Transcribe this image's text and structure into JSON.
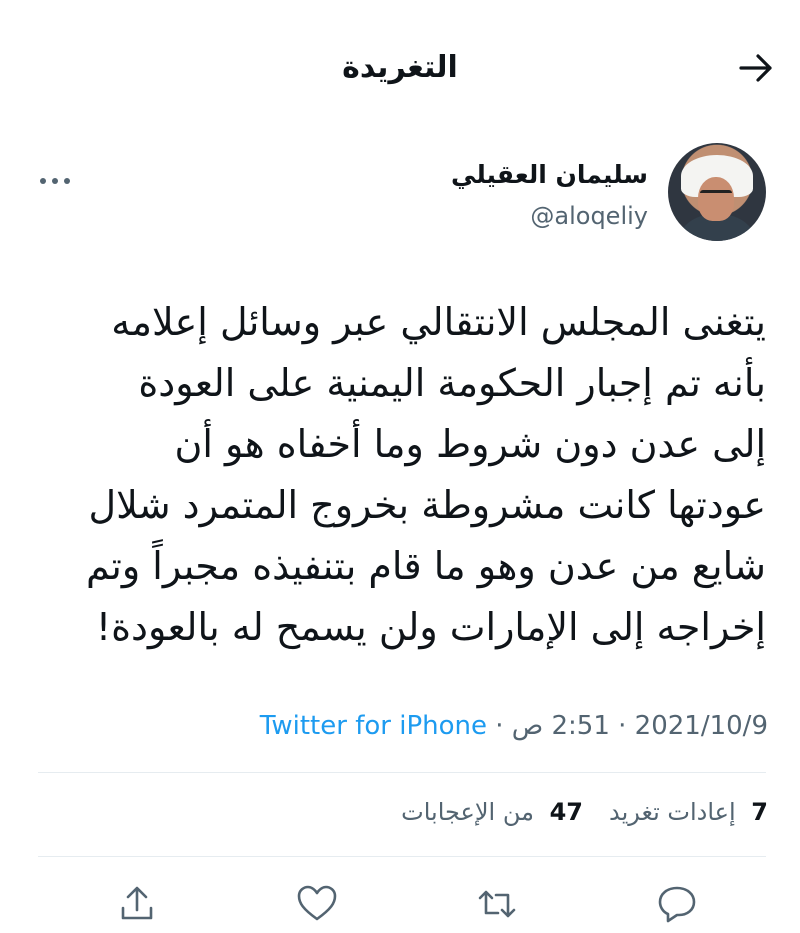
{
  "header": {
    "title": "التغريدة"
  },
  "author": {
    "name": "سليمان العقيلي",
    "handle": "@aloqeliy"
  },
  "tweet": {
    "text": "يتغنى المجلس الانتقالي عبر وسائل إعلامه\nبأنه تم إجبار الحكومة اليمنية على العودة\nإلى عدن دون شروط وما أخفاه هو أن\nعودتها كانت مشروطة بخروج المتمرد شلال\nشايع من عدن وهو ما قام بتنفيذه مجبراً وتم\nإخراجه إلى الإمارات ولن يسمح له بالعودة!"
  },
  "meta": {
    "date": "2021/10/9",
    "time": "2:51 ص",
    "source": "Twitter for iPhone",
    "sep": "·"
  },
  "stats": {
    "retweets_count": "7",
    "retweets_label": "إعادات تغريد",
    "likes_count": "47",
    "likes_label": "من الإعجابات"
  },
  "icons": {
    "back": "arrow-right-icon",
    "more": "more-dots-icon",
    "reply": "reply-icon",
    "retweet": "retweet-icon",
    "like": "heart-icon",
    "share": "share-icon"
  },
  "colors": {
    "link": "#1d9bf0",
    "secondary": "#536471",
    "text": "#0f1419"
  }
}
